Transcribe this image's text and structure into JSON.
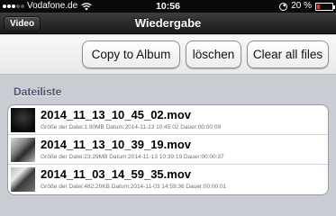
{
  "status_bar": {
    "carrier": "Vodafone.de",
    "time": "10:56",
    "battery_percent": "20 %",
    "battery_level": 0.2,
    "battery_color": "#e3342f"
  },
  "nav": {
    "back_label": "Video",
    "title": "Wiedergabe"
  },
  "toolbar": {
    "copy_label": "Copy to Album",
    "delete_label": "löschen",
    "clear_label": "Clear all files"
  },
  "list": {
    "header": "Dateiliste",
    "items": [
      {
        "name": "2014_11_13_10_45_02.mov",
        "info": "Größe der Datei:1.90MB  Datum:2014-11-13 10:45:02  Dauer:00:00:09",
        "thumb_icon": "video-thumbnail"
      },
      {
        "name": "2014_11_13_10_39_19.mov",
        "info": "Größe der Datei:23.29MB  Datum:2014-11-13 10:39:19  Dauer:00:00:37",
        "thumb_icon": "video-thumbnail"
      },
      {
        "name": "2014_11_03_14_59_35.mov",
        "info": "Größe der Datei:482.20KB  Datum:2014-11-03 14:59:36  Dauer:00:00:01",
        "thumb_icon": "video-thumbnail"
      }
    ]
  }
}
